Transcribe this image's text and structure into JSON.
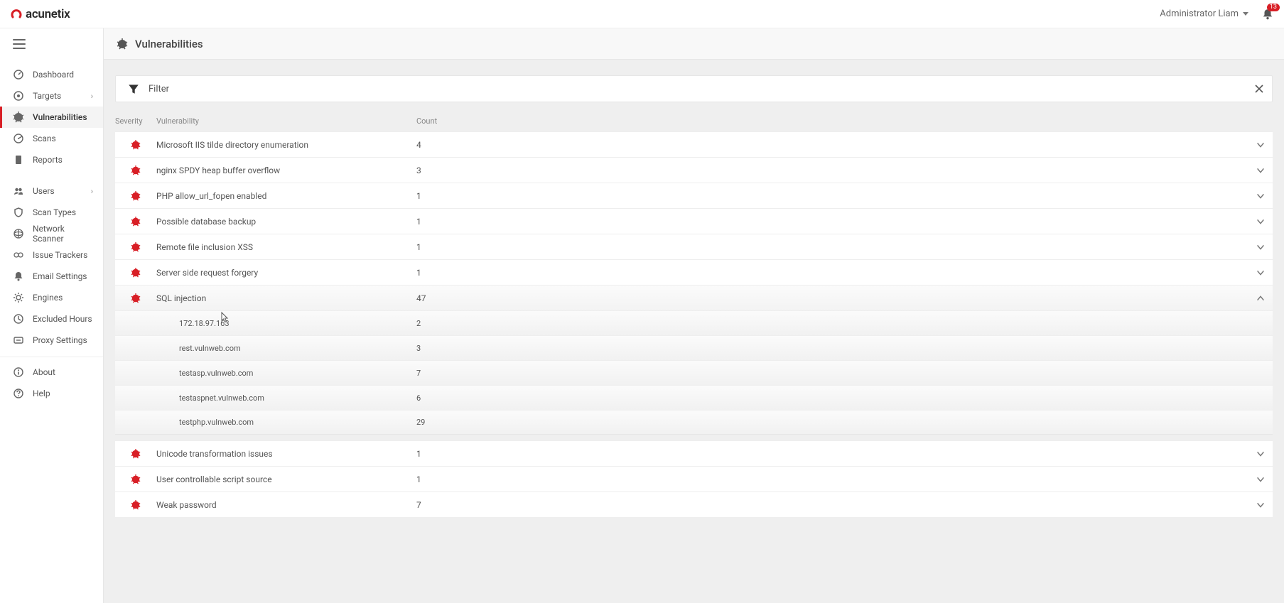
{
  "brand": "acunetix",
  "user_name": "Administrator Liam",
  "notification_count": "13",
  "page_title": "Vulnerabilities",
  "filter_label": "Filter",
  "sidebar": {
    "items": [
      {
        "label": "Dashboard"
      },
      {
        "label": "Targets"
      },
      {
        "label": "Vulnerabilities"
      },
      {
        "label": "Scans"
      },
      {
        "label": "Reports"
      },
      {
        "label": "Users"
      },
      {
        "label": "Scan Types"
      },
      {
        "label": "Network Scanner"
      },
      {
        "label": "Issue Trackers"
      },
      {
        "label": "Email Settings"
      },
      {
        "label": "Engines"
      },
      {
        "label": "Excluded Hours"
      },
      {
        "label": "Proxy Settings"
      }
    ],
    "footer": [
      {
        "label": "About"
      },
      {
        "label": "Help"
      }
    ]
  },
  "columns": {
    "severity": "Severity",
    "vulnerability": "Vulnerability",
    "count": "Count"
  },
  "rows": [
    {
      "name": "Microsoft IIS tilde directory enumeration",
      "count": "4"
    },
    {
      "name": "nginx SPDY heap buffer overflow",
      "count": "3"
    },
    {
      "name": "PHP allow_url_fopen enabled",
      "count": "1"
    },
    {
      "name": "Possible database backup",
      "count": "1"
    },
    {
      "name": "Remote file inclusion XSS",
      "count": "1"
    },
    {
      "name": "Server side request forgery",
      "count": "1"
    },
    {
      "name": "SQL injection",
      "count": "47"
    },
    {
      "name": "Unicode transformation issues",
      "count": "1"
    },
    {
      "name": "User controllable script source",
      "count": "1"
    },
    {
      "name": "Weak password",
      "count": "7"
    }
  ],
  "expanded_children": [
    {
      "name": "172.18.97.163",
      "count": "2"
    },
    {
      "name": "rest.vulnweb.com",
      "count": "3"
    },
    {
      "name": "testasp.vulnweb.com",
      "count": "7"
    },
    {
      "name": "testaspnet.vulnweb.com",
      "count": "6"
    },
    {
      "name": "testphp.vulnweb.com",
      "count": "29"
    }
  ]
}
